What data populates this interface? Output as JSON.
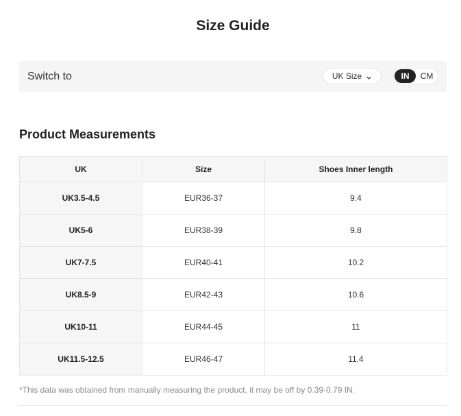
{
  "page": {
    "title": "Size Guide"
  },
  "switch": {
    "label": "Switch to",
    "size_select": {
      "value": "UK Size",
      "icon": "chevron-down-icon"
    },
    "unit_toggle": {
      "options": [
        "IN",
        "CM"
      ],
      "selected": "IN"
    }
  },
  "measurements": {
    "heading": "Product Measurements",
    "columns": [
      "UK",
      "Size",
      "Shoes Inner length"
    ],
    "rows": [
      [
        "UK3.5-4.5",
        "EUR36-37",
        "9.4"
      ],
      [
        "UK5-6",
        "EUR38-39",
        "9.8"
      ],
      [
        "UK7-7.5",
        "EUR40-41",
        "10.2"
      ],
      [
        "UK8.5-9",
        "EUR42-43",
        "10.6"
      ],
      [
        "UK10-11",
        "EUR44-45",
        "11"
      ],
      [
        "UK11.5-12.5",
        "EUR46-47",
        "11.4"
      ]
    ],
    "note": "*This data was obtained from manually measuring the product, it may be off by 0.39-0.79 IN."
  },
  "colors": {
    "text": "#222222",
    "panel_bg": "#f5f5f5",
    "toggle_active_bg": "#222222",
    "note_text": "#8a8a8a",
    "border": "#e4e4e4"
  }
}
